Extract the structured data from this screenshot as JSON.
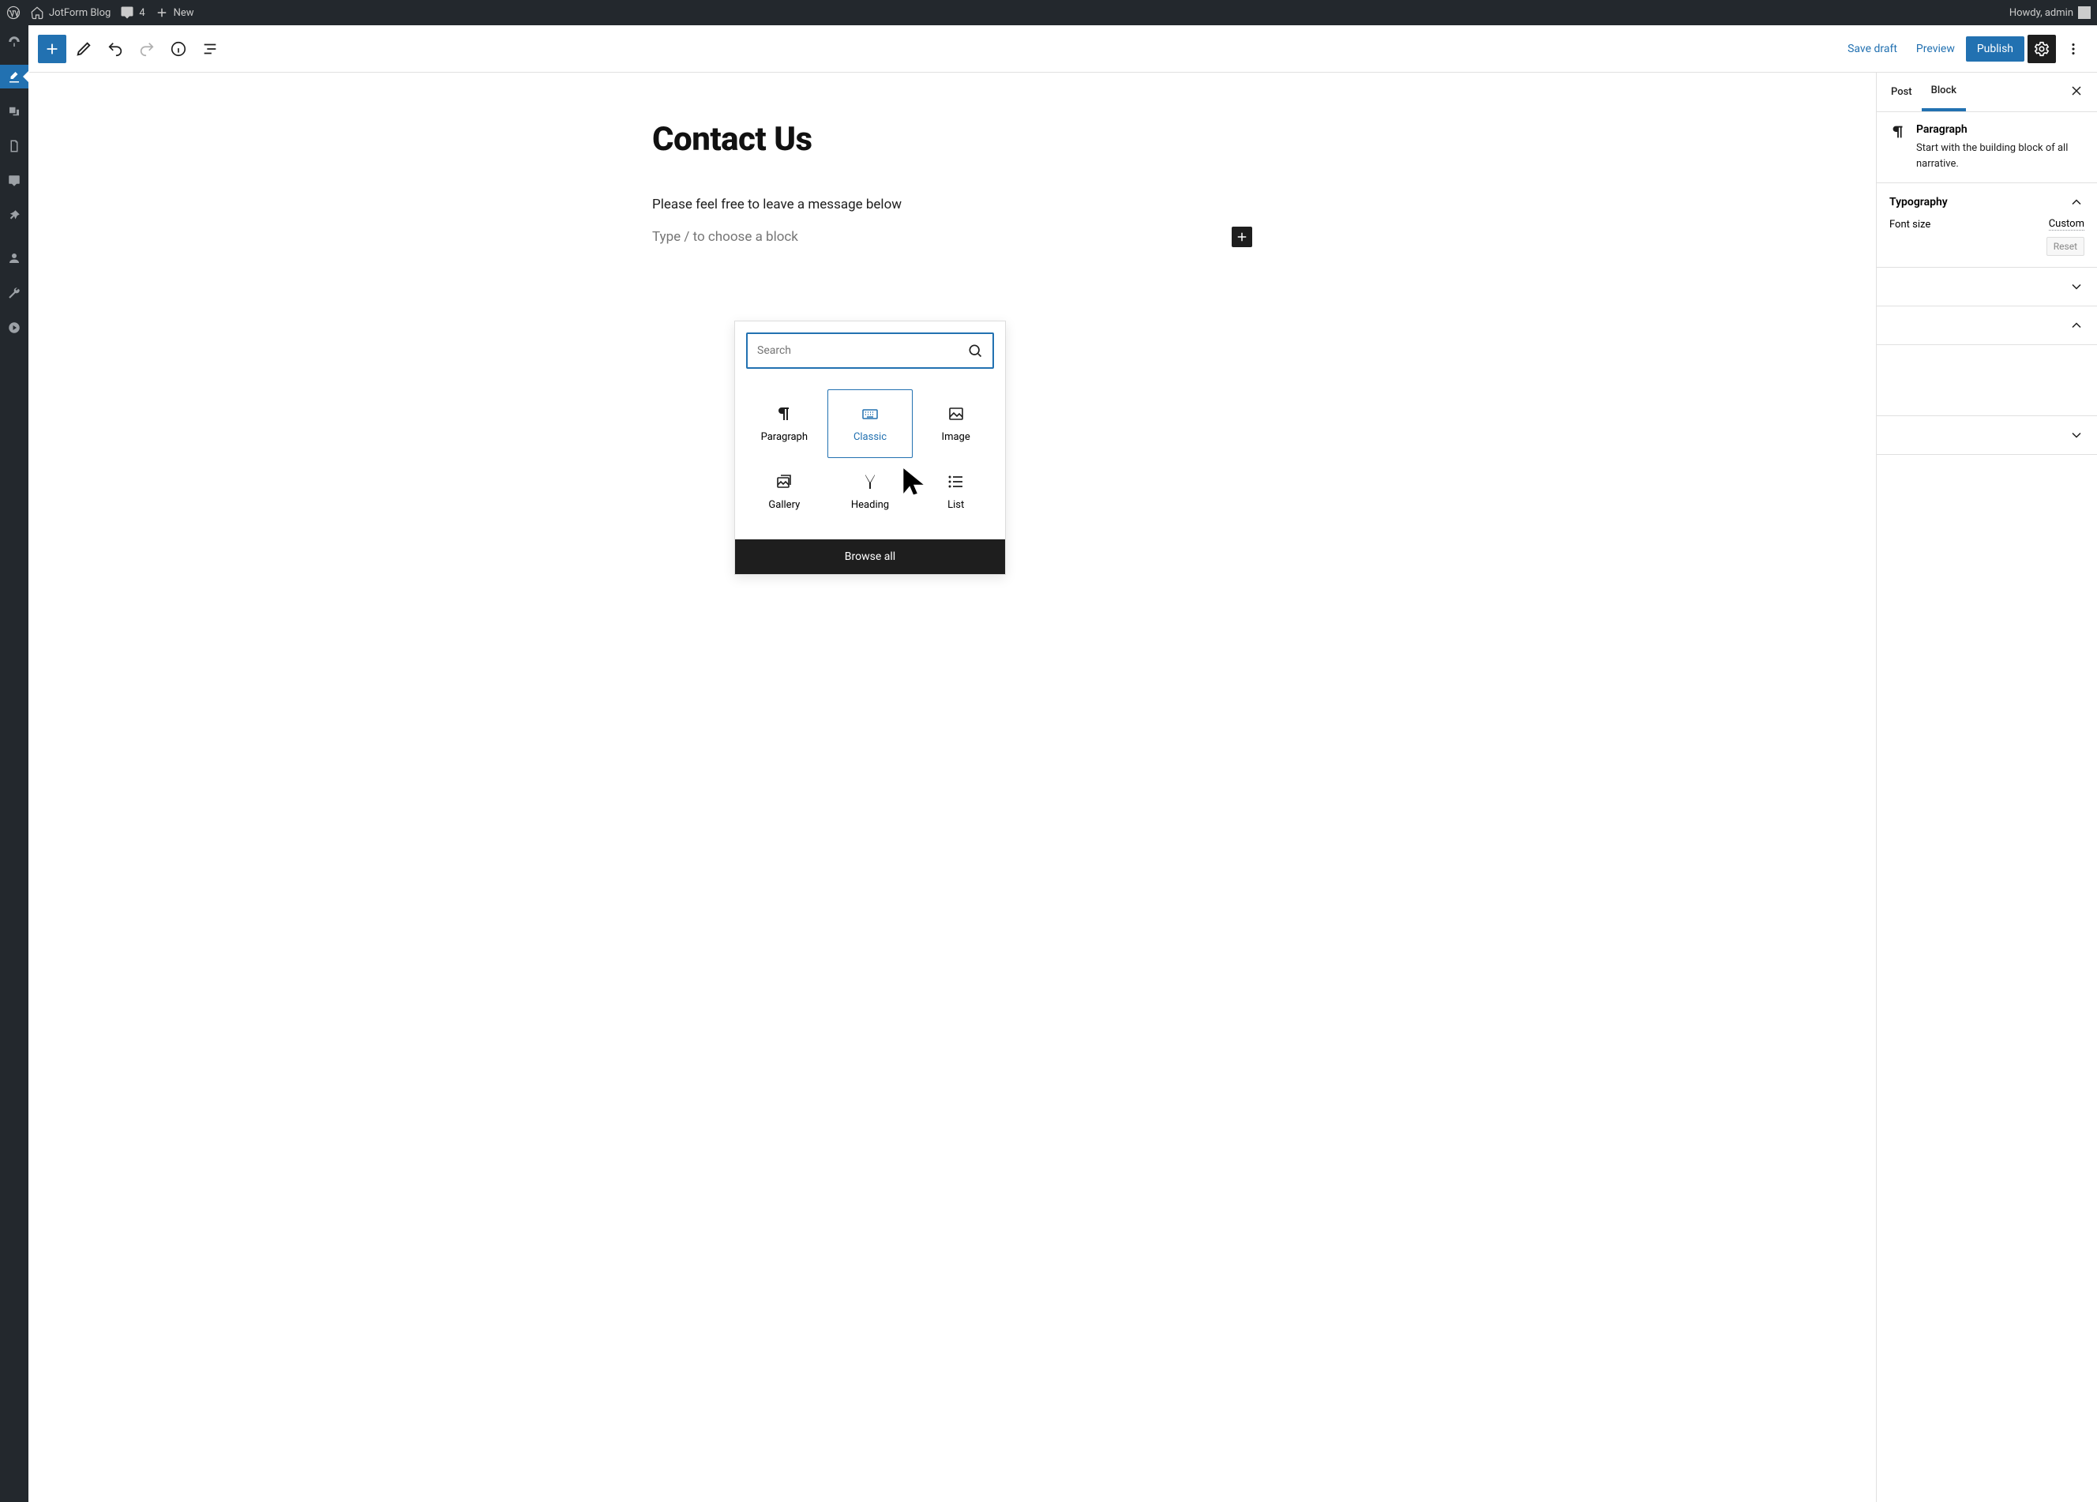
{
  "adminbar": {
    "site_name": "JotForm Blog",
    "comments_count": "4",
    "new_label": "New",
    "greeting": "Howdy, admin"
  },
  "toolbar": {
    "save_draft": "Save draft",
    "preview": "Preview",
    "publish": "Publish"
  },
  "editor": {
    "title": "Contact Us",
    "paragraph": "Please feel free to leave a message below",
    "placeholder": "Type / to choose a block"
  },
  "inspector": {
    "tabs": {
      "post": "Post",
      "block": "Block"
    },
    "block": {
      "name": "Paragraph",
      "desc": "Start with the building block of all narrative."
    },
    "typography": {
      "title": "Typography",
      "font_size_label": "Font size",
      "custom_label": "Custom",
      "reset_label": "Reset"
    }
  },
  "inserter": {
    "search_placeholder": "Search",
    "items": [
      {
        "label": "Paragraph"
      },
      {
        "label": "Classic"
      },
      {
        "label": "Image"
      },
      {
        "label": "Gallery"
      },
      {
        "label": "Heading"
      },
      {
        "label": "List"
      }
    ],
    "browse_all": "Browse all"
  }
}
